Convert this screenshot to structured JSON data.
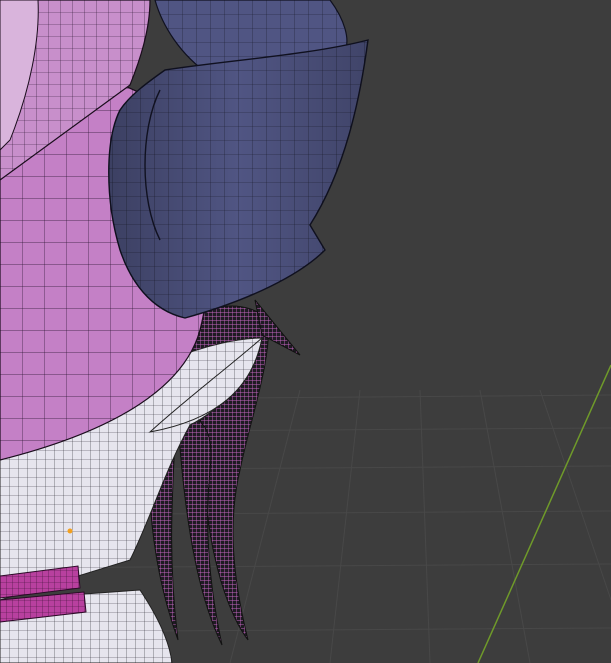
{
  "app": {
    "name": ""
  },
  "viewport": {
    "mode": "3d-viewport",
    "shading": "wireframe-overlay",
    "colors": {
      "background": "#3d3d3d",
      "grid": "#4a4a4a",
      "y_axis": "#6f9a2a",
      "body_pink": "#c07ac4",
      "horn_blue": "#4b4f7e",
      "skin_white": "#e9e8f0",
      "hair_dark": "#1c1a20",
      "hair_pink": "#c060bf",
      "collar": "#b8409f",
      "vertex_highlight": "#f2a020"
    }
  }
}
